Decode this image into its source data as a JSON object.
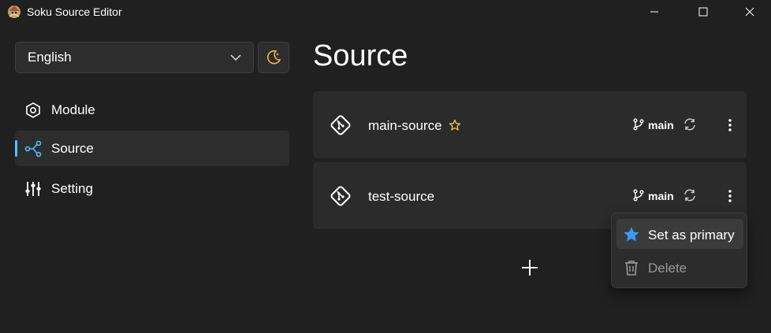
{
  "window": {
    "title": "Soku Source Editor"
  },
  "sidebar": {
    "language": {
      "selected": "English"
    },
    "nav": [
      {
        "label": "Module",
        "icon": "hexagon-icon",
        "active": false
      },
      {
        "label": "Source",
        "icon": "share-icon",
        "active": true
      },
      {
        "label": "Setting",
        "icon": "sliders-icon",
        "active": false
      }
    ]
  },
  "main": {
    "title": "Source",
    "sources": [
      {
        "name": "main-source",
        "primary": true,
        "branch": "main"
      },
      {
        "name": "test-source",
        "primary": false,
        "branch": "main"
      }
    ]
  },
  "context_menu": {
    "items": [
      {
        "label": "Set as primary",
        "icon": "star-icon"
      },
      {
        "label": "Delete",
        "icon": "trash-icon"
      }
    ]
  },
  "colors": {
    "background": "#202020",
    "card": "#2b2b2b",
    "accent": "#4cc2ff",
    "star_outline": "#f7c948",
    "star_fill": "#3b9bf5"
  }
}
